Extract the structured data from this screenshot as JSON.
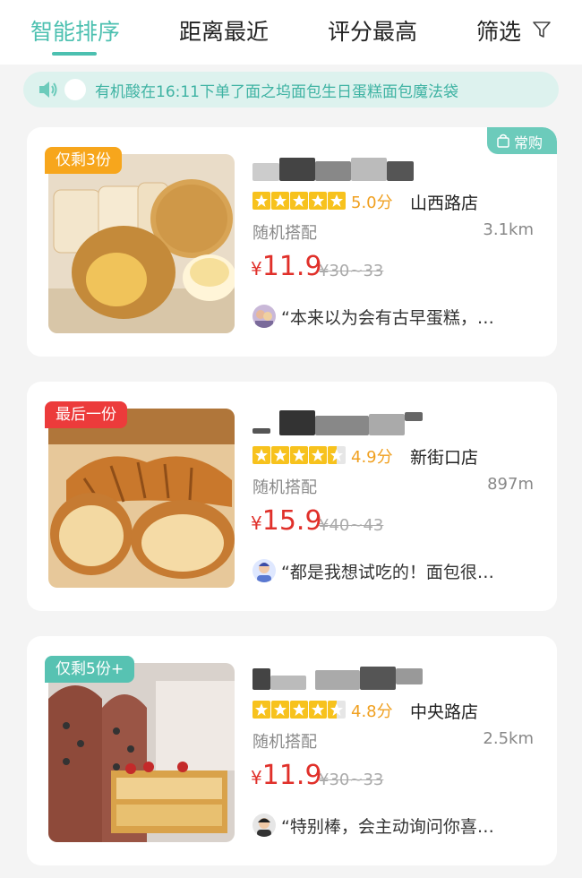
{
  "tabs": [
    {
      "label": "智能排序",
      "active": true
    },
    {
      "label": "距离最近",
      "active": false
    },
    {
      "label": "评分最高",
      "active": false
    },
    {
      "label": "筛选",
      "active": false
    }
  ],
  "filter_icon": "funnel-icon",
  "notice": {
    "icon": "speaker-icon",
    "text": "有机酸在16:11下单了面之坞面包生日蛋糕面包魔法袋"
  },
  "colors": {
    "accent": "#4cc0b0",
    "price": "#e0302a",
    "score": "#f0a020",
    "star": "#f7c21d"
  },
  "cards": [
    {
      "badge": "仅剩3份",
      "badge_color": "#f7a61c",
      "corner_tag": "常购",
      "rating": 5.0,
      "score": "5.0分",
      "store": "山西路店",
      "category": "随机搭配",
      "distance": "3.1km",
      "price_symbol": "¥",
      "price": "11.9",
      "original_price": "¥30~33",
      "review": "“本来以为会有古早蛋糕，…"
    },
    {
      "badge": "最后一份",
      "badge_color": "#ec3b3b",
      "rating": 4.5,
      "score": "4.9分",
      "store": "新街口店",
      "category": "随机搭配",
      "distance": "897m",
      "price_symbol": "¥",
      "price": "15.9",
      "original_price": "¥40~43",
      "review": "“都是我想试吃的！面包很…"
    },
    {
      "badge": "仅剩5份+",
      "badge_color": "#57c2b2",
      "rating": 4.5,
      "score": "4.8分",
      "store": "中央路店",
      "category": "随机搭配",
      "distance": "2.5km",
      "price_symbol": "¥",
      "price": "11.9",
      "original_price": "¥30~33",
      "review": "“特别棒，会主动询问你喜…"
    }
  ]
}
